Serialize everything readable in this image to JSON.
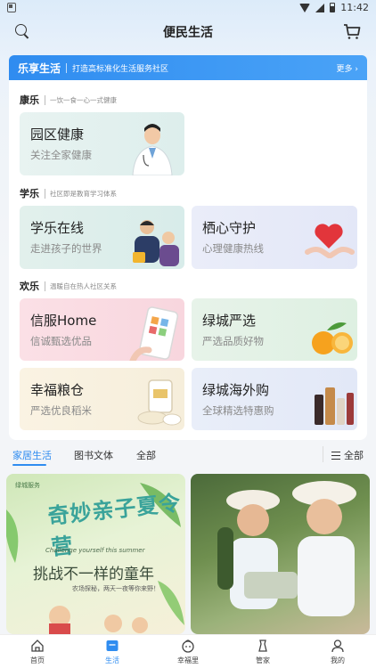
{
  "status_bar": {
    "time": "11:42"
  },
  "header": {
    "title": "便民生活"
  },
  "banner": {
    "brand": "乐享生活",
    "slogan": "打造高标准化生活服务社区",
    "more": "更多"
  },
  "sections": [
    {
      "title": "康乐",
      "subtitle": "一饮一食一心一式健康"
    },
    {
      "title": "学乐",
      "subtitle": "社区即是教育学习体系"
    },
    {
      "title": "欢乐",
      "subtitle": "温暖自在热人社区关系"
    }
  ],
  "cards": {
    "health": {
      "title": "园区健康",
      "subtitle": "关注全家健康"
    },
    "study": {
      "title": "学乐在线",
      "subtitle": "走进孩子的世界"
    },
    "mind": {
      "title": "栖心守护",
      "subtitle": "心理健康热线"
    },
    "xinfu": {
      "title": "信服Home",
      "subtitle": "信诚甄选优品"
    },
    "lvcheng": {
      "title": "绿城严选",
      "subtitle": "严选品质好物"
    },
    "grain": {
      "title": "幸福粮仓",
      "subtitle": "严选优良稻米"
    },
    "overseas": {
      "title": "绿城海外购",
      "subtitle": "全球精选特惠购"
    }
  },
  "tabs": [
    {
      "label": "家居生活"
    },
    {
      "label": "图书文体"
    },
    {
      "label": "全部"
    }
  ],
  "all_button": "全部",
  "feed": {
    "poster_title": "奇妙亲子夏令营",
    "poster_sub": "Challenge yourself this summer",
    "poster_line": "挑战不一样的童年",
    "poster_note": "农场探秘，两天一夜等你来野！",
    "brand_tag": "绿城服务"
  },
  "bottom_nav": [
    {
      "label": "首页"
    },
    {
      "label": "生活"
    },
    {
      "label": "幸福里"
    },
    {
      "label": "管家"
    },
    {
      "label": "我的"
    }
  ],
  "colors": {
    "accent": "#2f8cf0",
    "orange": "#f6a21e",
    "red": "#e2353b"
  }
}
